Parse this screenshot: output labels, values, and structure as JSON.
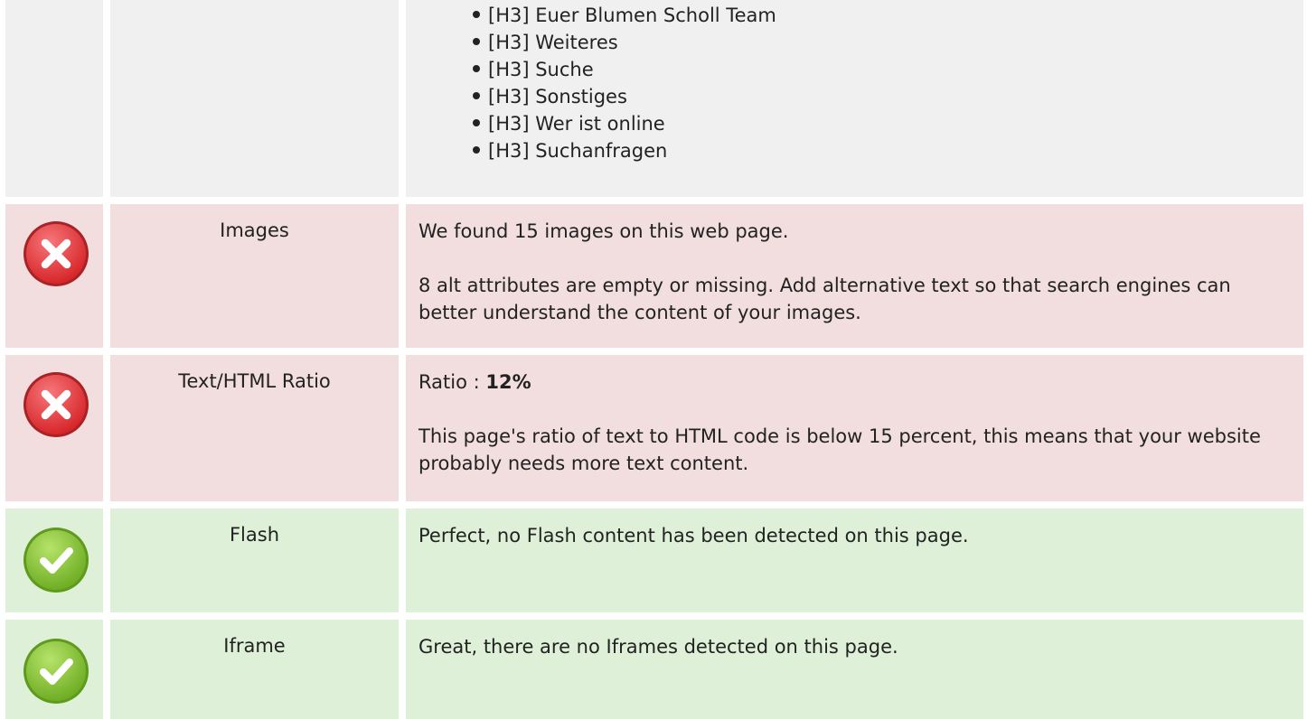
{
  "headings_row": {
    "items": [
      "[H3] Euer Blumen Scholl Team",
      "[H3] Weiteres",
      "[H3] Suche",
      "[H3] Sonstiges",
      "[H3] Wer ist online",
      "[H3] Suchanfragen"
    ]
  },
  "images": {
    "status": "error",
    "icon": "error-x-icon",
    "label": "Images",
    "line1": "We found 15 images on this web page.",
    "line2": "8 alt attributes are empty or missing. Add alternative text so that search engines can better understand the content of your images."
  },
  "ratio": {
    "status": "error",
    "icon": "error-x-icon",
    "label": "Text/HTML Ratio",
    "prefix": "Ratio : ",
    "value": "12%",
    "line2": "This page's ratio of text to HTML code is below 15 percent, this means that your website probably needs more text content."
  },
  "flash": {
    "status": "ok",
    "icon": "check-icon",
    "label": "Flash",
    "line1": "Perfect, no Flash content has been detected on this page."
  },
  "iframe": {
    "status": "ok",
    "icon": "check-icon",
    "label": "Iframe",
    "line1": "Great, there are no Iframes detected on this page."
  },
  "colors": {
    "neutral_bg": "#f0f0f0",
    "error_bg": "#f2dede",
    "ok_bg": "#dff0d8",
    "error_icon": "#e2393b",
    "ok_icon": "#8cc63e"
  }
}
